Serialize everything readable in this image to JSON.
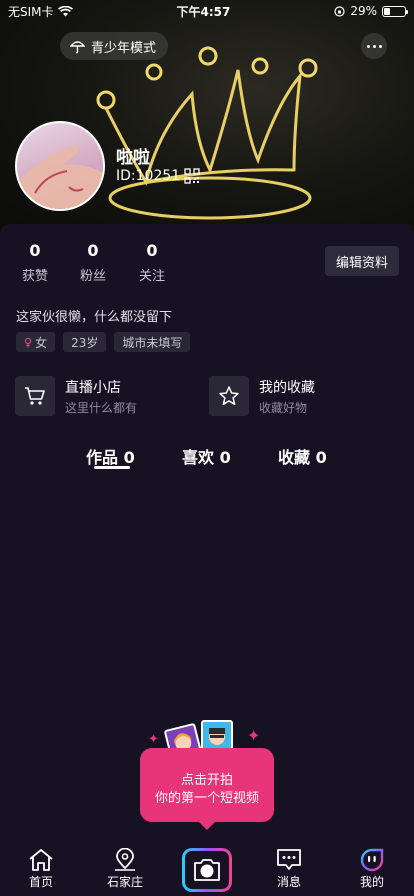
{
  "status_bar": {
    "carrier": "无SIM卡",
    "time": "下午4:57",
    "battery": "29%",
    "battery_level": 0.29
  },
  "header": {
    "teen_mode_label": "青少年模式"
  },
  "profile": {
    "nickname": "啦啦",
    "id": "ID:10251"
  },
  "stats": [
    {
      "value": "0",
      "label": "获赞"
    },
    {
      "value": "0",
      "label": "粉丝"
    },
    {
      "value": "0",
      "label": "关注"
    }
  ],
  "edit_label": "编辑资料",
  "bio": "这家伙很懒，什么都没留下",
  "tags": {
    "gender": "女",
    "age": "23岁",
    "city": "城市未填写"
  },
  "features": [
    {
      "title": "直播小店",
      "subtitle": "这里什么都有",
      "icon": "cart-icon"
    },
    {
      "title": "我的收藏",
      "subtitle": "收藏好物",
      "icon": "star-icon"
    }
  ],
  "tabs": [
    {
      "label": "作品 0",
      "active": true
    },
    {
      "label": "喜欢 0",
      "active": false
    },
    {
      "label": "收藏 0",
      "active": false
    }
  ],
  "record_prompt": {
    "line1": "点击开拍",
    "line2": "你的第一个短视频"
  },
  "bottom_nav": [
    {
      "label": "首页",
      "icon": "home-icon"
    },
    {
      "label": "石家庄",
      "icon": "location-icon"
    },
    {
      "label": "",
      "icon": "camera-icon"
    },
    {
      "label": "消息",
      "icon": "message-icon"
    },
    {
      "label": "我的",
      "icon": "profile-face-icon",
      "active": true
    }
  ],
  "colors": {
    "background": "#161224",
    "accent": "#e8357a",
    "crown_glow": "#f3d86a"
  }
}
